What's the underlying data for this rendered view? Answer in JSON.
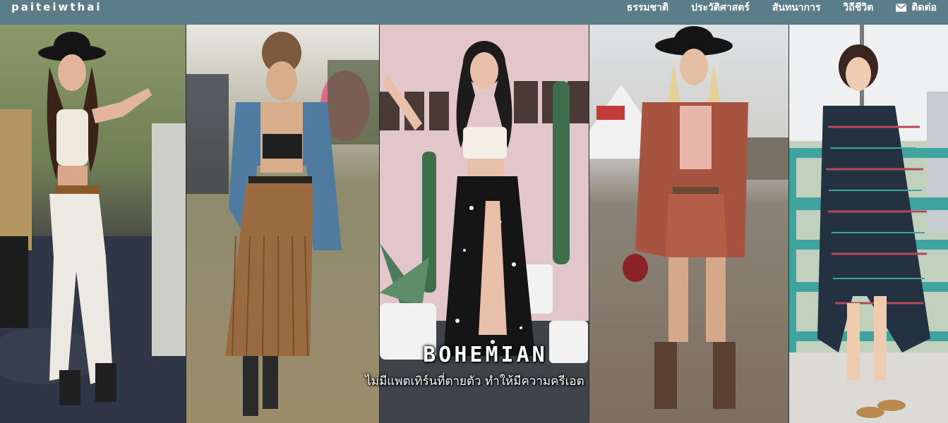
{
  "navbar": {
    "brand": "paiteiwthai",
    "items": [
      {
        "label": "ธรรมชาติ"
      },
      {
        "label": "ประวัติศาสตร์"
      },
      {
        "label": "สันทนาการ"
      },
      {
        "label": "วิถีชีวิต"
      },
      {
        "label": "ติดต่อ",
        "icon": "envelope-icon"
      }
    ],
    "background": "#5b7d8a"
  },
  "hero": {
    "title": "BOHEMIAN",
    "subtitle": "ไม่มีแพตเทิร์นที่ตายตัว ทำให้มีความครีเอต"
  }
}
